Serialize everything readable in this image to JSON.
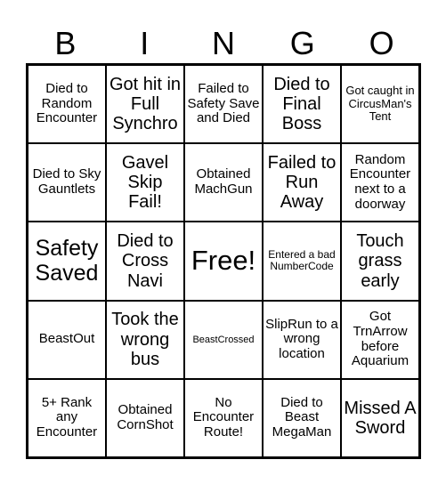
{
  "header": {
    "letters": [
      "B",
      "I",
      "N",
      "G",
      "O"
    ]
  },
  "cells": [
    "Died to Random Encounter",
    "Got hit in Full Synchro",
    "Failed to Safety Save and Died",
    "Died to Final Boss",
    "Got caught in CircusMan's Tent",
    "Died to Sky Gauntlets",
    "Gavel Skip Fail!",
    "Obtained MachGun",
    "Failed to Run Away",
    "Random Encounter next to a doorway",
    "Safety Saved",
    "Died to Cross Navi",
    "Free!",
    "Entered a bad NumberCode",
    "Touch grass early",
    "BeastOut",
    "Took the wrong bus",
    "BeastCrossed",
    "SlipRun to a wrong location",
    "Got TrnArrow before Aquarium",
    "5+ Rank any Encounter",
    "Obtained CornShot",
    "No Encounter Route!",
    "Died to Beast MegaMan",
    "Missed A Sword"
  ]
}
